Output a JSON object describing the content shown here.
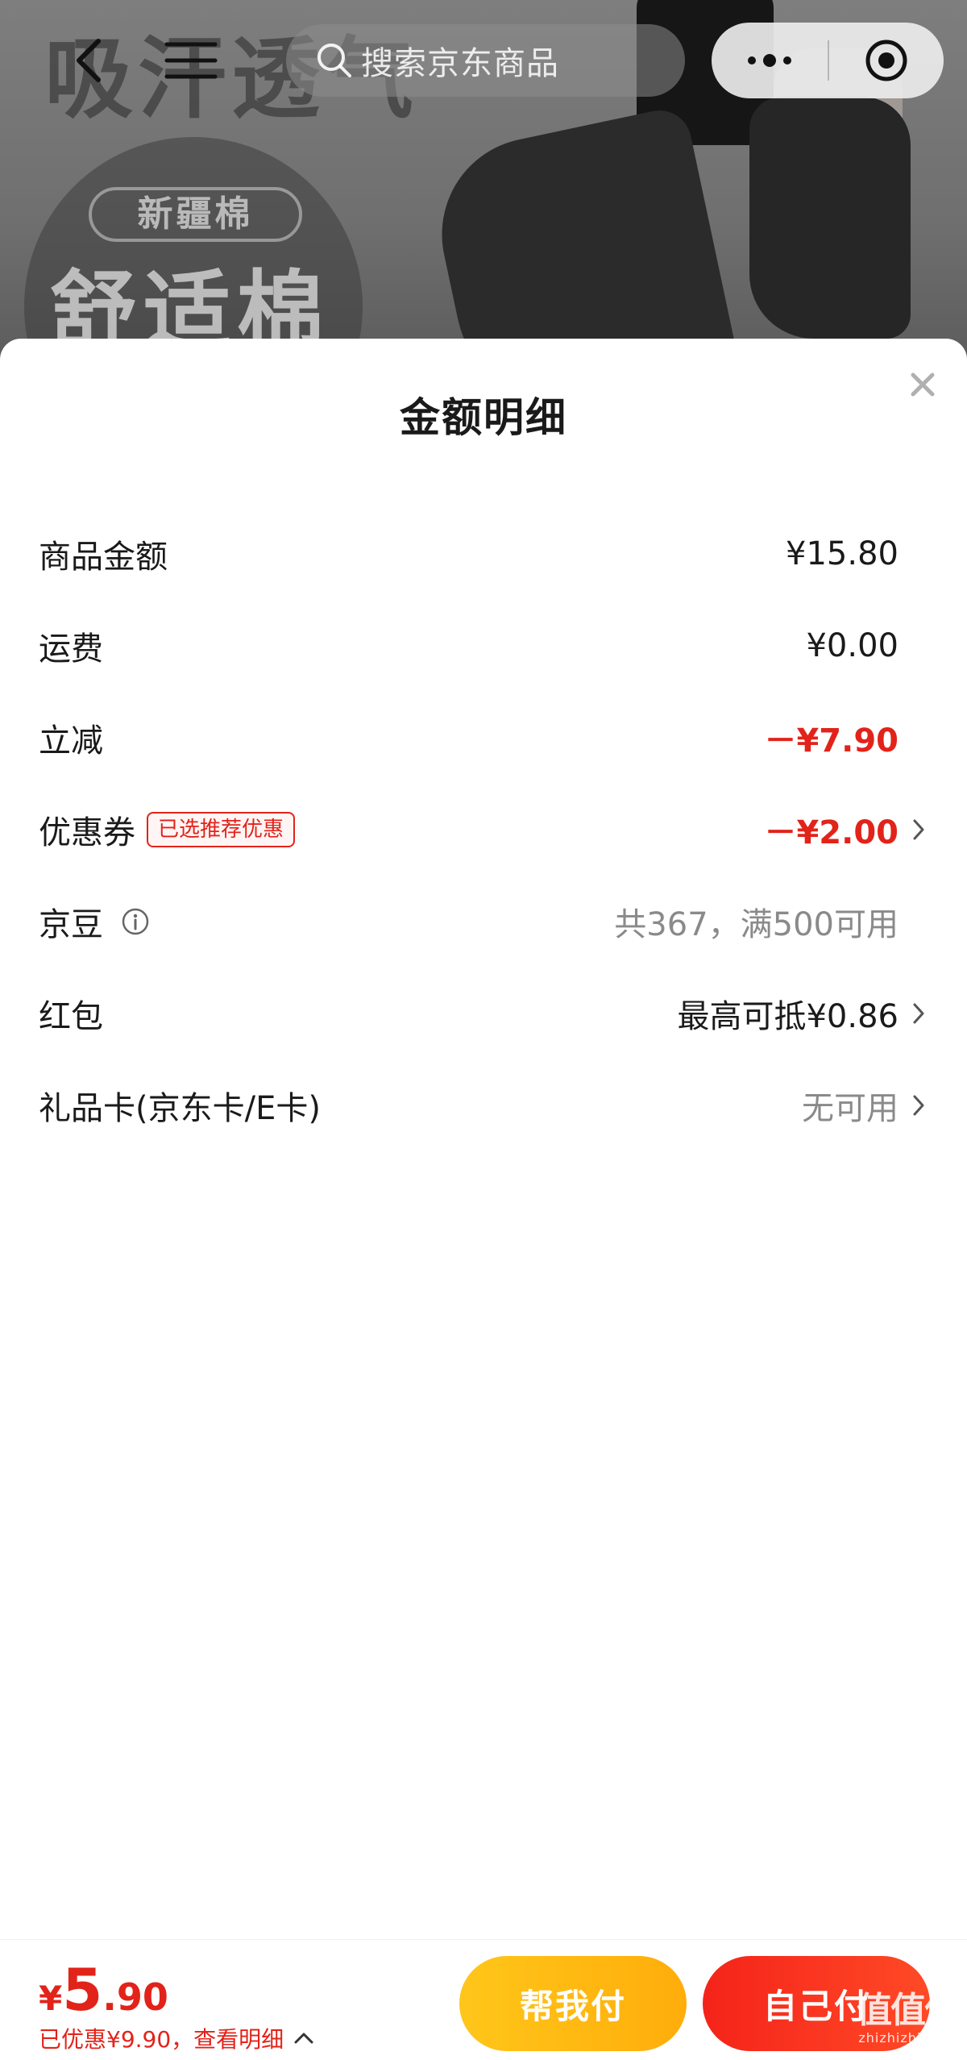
{
  "background": {
    "promo_text": "吸汗透气",
    "circle_tag": "新疆棉",
    "circle_text": "舒适棉"
  },
  "top_nav": {
    "search_placeholder": "搜索京东商品"
  },
  "sheet": {
    "title": "金额明细",
    "rows": [
      {
        "label": "商品金额",
        "value": "¥15.80"
      },
      {
        "label": "运费",
        "value": "¥0.00"
      },
      {
        "label": "立减",
        "value": "－¥7.90"
      },
      {
        "label": "优惠券",
        "badge": "已选推荐优惠",
        "value": "－¥2.00"
      },
      {
        "label": "京豆",
        "value": "共367，满500可用"
      },
      {
        "label": "红包",
        "value": "最高可抵¥0.86"
      },
      {
        "label": "礼品卡(京东卡/E卡)",
        "value": "无可用"
      }
    ]
  },
  "footer": {
    "price_symbol": "¥",
    "price_integer": "5",
    "price_decimal": ".90",
    "saving_text": "已优惠¥9.90，查看明细",
    "help_pay_label": "帮我付",
    "self_pay_label": "自己付"
  },
  "watermark": {
    "mark": "值值值",
    "text": "zhizhizhi.com"
  },
  "colors": {
    "accent_red": "#e2231a",
    "help_pay_yellow": "#ffb811",
    "self_pay_red": "#f5231a"
  }
}
